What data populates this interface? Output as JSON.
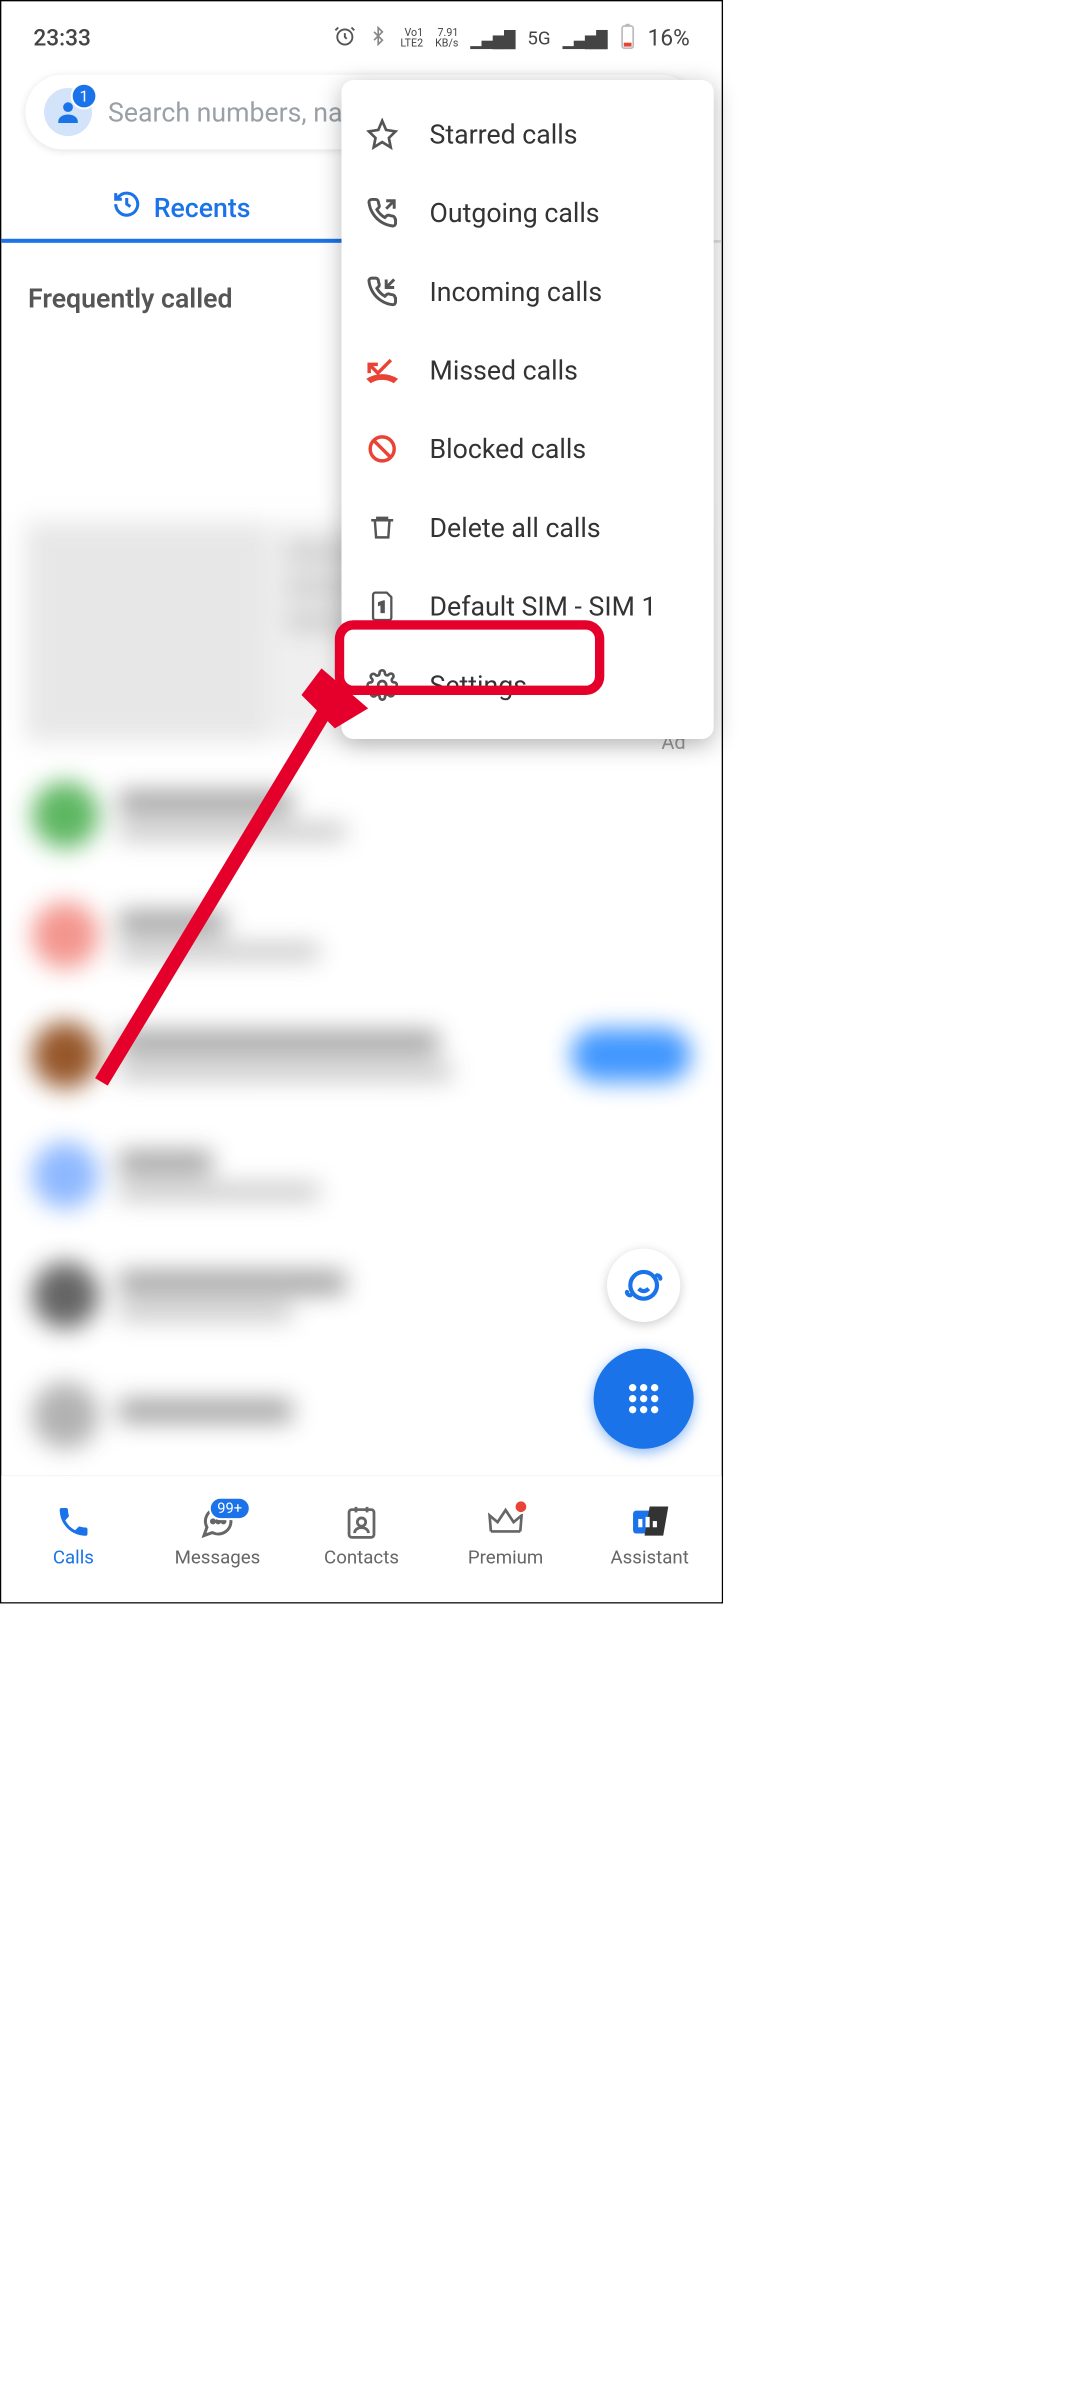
{
  "status": {
    "time": "23:33",
    "alarm_icon": "alarm-icon",
    "bt_icon": "bluetooth-icon",
    "vol": "VoLTE2",
    "speed": "7.91 KB/s",
    "network": "5G",
    "battery": "16%"
  },
  "search": {
    "badge": "1",
    "placeholder": "Search numbers, names"
  },
  "tabs": {
    "recents": "Recents"
  },
  "section": {
    "frequently_called": "Frequently called"
  },
  "ad_label": "Ad",
  "menu": {
    "items": [
      {
        "icon": "star-icon",
        "label": "Starred calls"
      },
      {
        "icon": "call-outgoing-icon",
        "label": "Outgoing calls"
      },
      {
        "icon": "call-incoming-icon",
        "label": "Incoming calls"
      },
      {
        "icon": "call-missed-icon",
        "label": "Missed calls",
        "cls": "missed"
      },
      {
        "icon": "block-icon",
        "label": "Blocked calls",
        "cls": "blocked"
      },
      {
        "icon": "trash-icon",
        "label": "Delete all calls"
      },
      {
        "icon": "sim-icon",
        "label": "Default SIM - SIM 1"
      },
      {
        "icon": "gear-icon",
        "label": "Settings"
      }
    ]
  },
  "bottom_nav": {
    "calls": "Calls",
    "messages": "Messages",
    "messages_badge": "99+",
    "contacts": "Contacts",
    "premium": "Premium",
    "assistant": "Assistant"
  }
}
